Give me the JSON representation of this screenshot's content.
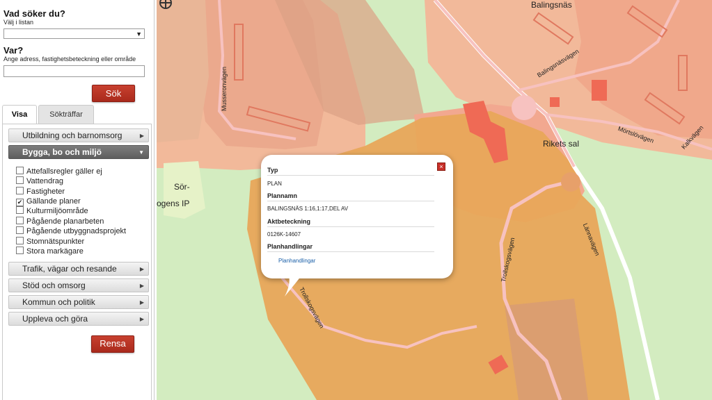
{
  "search": {
    "title": "Vad söker du?",
    "hint": "Välj i listan",
    "select_value": "",
    "where_title": "Var?",
    "where_hint": "Ange adress, fastighetsbeteckning eller område",
    "where_value": "",
    "search_button": "Sök"
  },
  "tabs": [
    {
      "label": "Visa",
      "active": true
    },
    {
      "label": "Sökträffar",
      "active": false
    }
  ],
  "categories": {
    "c1": "Utbildning och barnomsorg",
    "c2": "Bygga, bo och miljö",
    "c3": "Trafik, vägar och resande",
    "c4": "Stöd och omsorg",
    "c5": "Kommun och politik",
    "c6": "Uppleva och göra"
  },
  "layers": [
    {
      "label": "Attefallsregler gäller ej",
      "checked": false
    },
    {
      "label": "Vattendrag",
      "checked": false
    },
    {
      "label": "Fastigheter",
      "checked": false
    },
    {
      "label": "Gällande planer",
      "checked": true
    },
    {
      "label": "Kulturmiljöområde",
      "checked": false
    },
    {
      "label": "Pågående planarbeten",
      "checked": false
    },
    {
      "label": "Pågående utbyggnadsprojekt",
      "checked": false
    },
    {
      "label": "Stomnätspunkter",
      "checked": false
    },
    {
      "label": "Stora markägare",
      "checked": false
    }
  ],
  "clear_button": "Rensa",
  "map": {
    "labels": {
      "balingsnas": "Balingsnäs",
      "balingsnasvagen": "Balingsnäsvägen",
      "mortslovagen": "Mörtslövägen",
      "kalkvagen": "Kalkvägen",
      "rikets_sal": "Rikets sal",
      "sor": "Sör-",
      "ogens_ip": "ogens IP",
      "musseronvagen": "Musseronvägen",
      "lannavagen": "Lännavägen",
      "trollskogsvagen_1": "Trollskogsvägen",
      "trollskogsvagen_2": "Trollskogsvägen"
    }
  },
  "popup": {
    "typ_label": "Typ",
    "typ_value": "PLAN",
    "plannamn_label": "Plannamn",
    "plannamn_value": "BALINGSNÄS 1:16,1:17,DEL AV",
    "akt_label": "Aktbeteckning",
    "akt_value": "0126K-14607",
    "handlingar_label": "Planhandlingar",
    "handlingar_link": "Planhandlingar",
    "close_icon": "×"
  },
  "icons": {
    "dropdown": "dropdown-arrow-icon",
    "expand": "triangle-right-icon",
    "collapse": "triangle-down-icon",
    "locate": "crosshair-icon",
    "close": "close-icon"
  },
  "colors": {
    "accent_red": "#b3301f",
    "plan_orange": "#e9a65a",
    "building_red": "#f07058",
    "green": "#d3ecc0"
  }
}
